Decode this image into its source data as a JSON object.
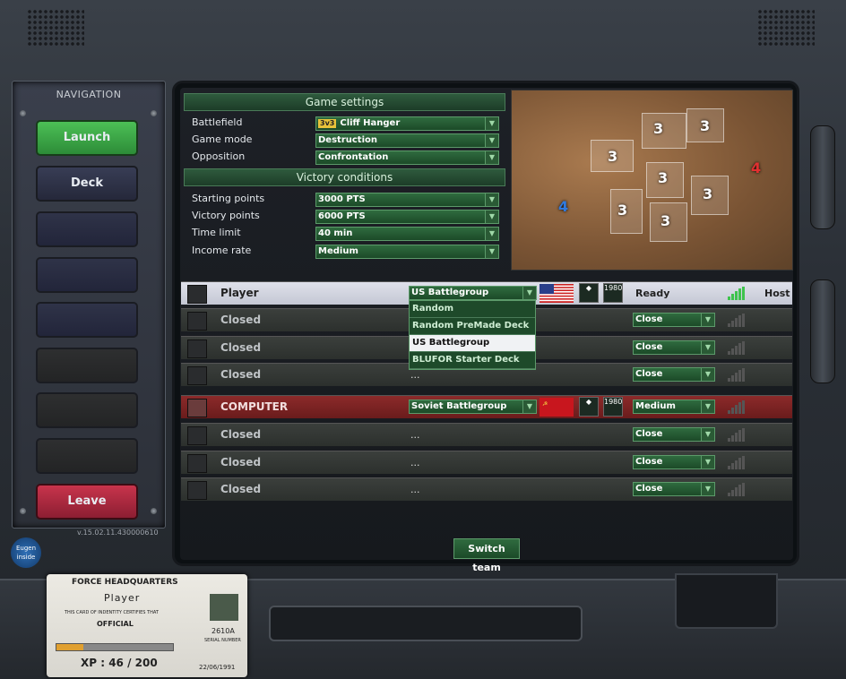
{
  "navigation": {
    "title": "NAVIGATION",
    "buttons": [
      {
        "label": "Launch"
      },
      {
        "label": "Deck"
      },
      {
        "label": "Leave"
      }
    ],
    "version": "v.15.02.11.430000610",
    "logo_text": "Eugen inside"
  },
  "game_settings": {
    "header": "Game settings",
    "battlefield_label": "Battlefield",
    "battlefield_tag": "3v3",
    "battlefield_value": "Cliff Hanger",
    "game_mode_label": "Game mode",
    "game_mode_value": "Destruction",
    "opposition_label": "Opposition",
    "opposition_value": "Confrontation"
  },
  "victory_conditions": {
    "header": "Victory conditions",
    "starting_points_label": "Starting points",
    "starting_points_value": "3000 PTS",
    "victory_points_label": "Victory points",
    "victory_points_value": "6000 PTS",
    "time_limit_label": "Time limit",
    "time_limit_value": "40 min",
    "income_rate_label": "Income rate",
    "income_rate_value": "Medium"
  },
  "map": {
    "zones": [
      "3",
      "3",
      "3",
      "3",
      "3",
      "3",
      "3",
      "4",
      "4"
    ],
    "colors": {
      "neutral": "#ffffff",
      "blue": "#2f7ae0",
      "red": "#e03030"
    }
  },
  "slots": [
    {
      "name": "Player",
      "deck": "US Battlegroup",
      "year": "1980",
      "status": "Ready",
      "role": "Host",
      "signal": 5
    },
    {
      "name": "Closed",
      "action": "Close",
      "signal": 0
    },
    {
      "name": "Closed",
      "action": "Close",
      "signal": 0
    },
    {
      "name": "Closed",
      "dots": "...",
      "action": "Close",
      "signal": 0
    },
    {
      "name": "COMPUTER",
      "deck": "Soviet Battlegroup",
      "year": "1980",
      "difficulty": "Medium",
      "signal": 0
    },
    {
      "name": "Closed",
      "dots": "...",
      "action": "Close",
      "signal": 0
    },
    {
      "name": "Closed",
      "dots": "...",
      "action": "Close",
      "signal": 0
    },
    {
      "name": "Closed",
      "dots": "...",
      "action": "Close",
      "signal": 0
    }
  ],
  "deck_dropdown": {
    "options": [
      "Random",
      "Random PreMade Deck",
      "US Battlegroup",
      "BLUFOR Starter Deck"
    ],
    "selected": "US Battlegroup"
  },
  "switch_team_label": "Switch team",
  "id_card": {
    "title": "FORCE HEADQUARTERS",
    "name": "Player",
    "certify": "THIS CARD OF INDENTITY CERTIFIES THAT",
    "rank": "OFFICIAL",
    "serial": "2610A",
    "serial_label": "SERIAL NUMBER",
    "xp": "XP : 46 / 200",
    "xp_progress": 0.23,
    "date": "22/06/1991"
  }
}
